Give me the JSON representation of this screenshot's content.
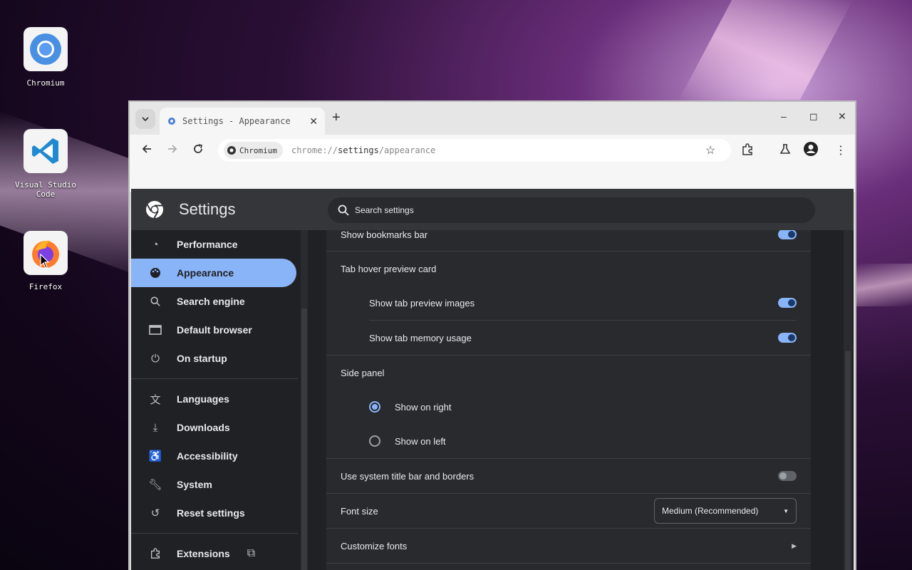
{
  "desktop": {
    "icons": [
      {
        "label": "Chromium"
      },
      {
        "label": "Visual Studio Code"
      },
      {
        "label": "Firefox"
      }
    ]
  },
  "browser": {
    "tab_title": "Settings - Appearance",
    "omnibox": {
      "chip_label": "Chromium",
      "url_prefix": "chrome://",
      "url_host": "settings",
      "url_path": "/appearance"
    }
  },
  "settings": {
    "title": "Settings",
    "search_placeholder": "Search settings",
    "nav": [
      {
        "label": "Performance",
        "icon": "speedometer-icon"
      },
      {
        "label": "Appearance",
        "icon": "palette-icon",
        "active": true
      },
      {
        "label": "Search engine",
        "icon": "search-icon"
      },
      {
        "label": "Default browser",
        "icon": "browser-window-icon"
      },
      {
        "label": "On startup",
        "icon": "power-icon"
      },
      {
        "label": "Languages",
        "icon": "translate-icon"
      },
      {
        "label": "Downloads",
        "icon": "download-icon"
      },
      {
        "label": "Accessibility",
        "icon": "accessibility-icon"
      },
      {
        "label": "System",
        "icon": "wrench-icon"
      },
      {
        "label": "Reset settings",
        "icon": "reset-icon"
      },
      {
        "label": "Extensions",
        "icon": "puzzle-icon"
      }
    ],
    "content": {
      "show_bookmarks_bar": "Show bookmarks bar",
      "tab_hover_header": "Tab hover preview card",
      "show_tab_preview_images": "Show tab preview images",
      "show_tab_memory_usage": "Show tab memory usage",
      "side_panel_header": "Side panel",
      "show_on_right": "Show on right",
      "show_on_left": "Show on left",
      "system_title_bar": "Use system title bar and borders",
      "font_size_label": "Font size",
      "font_size_value": "Medium (Recommended)",
      "customize_fonts": "Customize fonts"
    }
  },
  "colors": {
    "accent": "#8ab4f8",
    "page_bg": "#202124",
    "card_bg": "#292a2d"
  }
}
